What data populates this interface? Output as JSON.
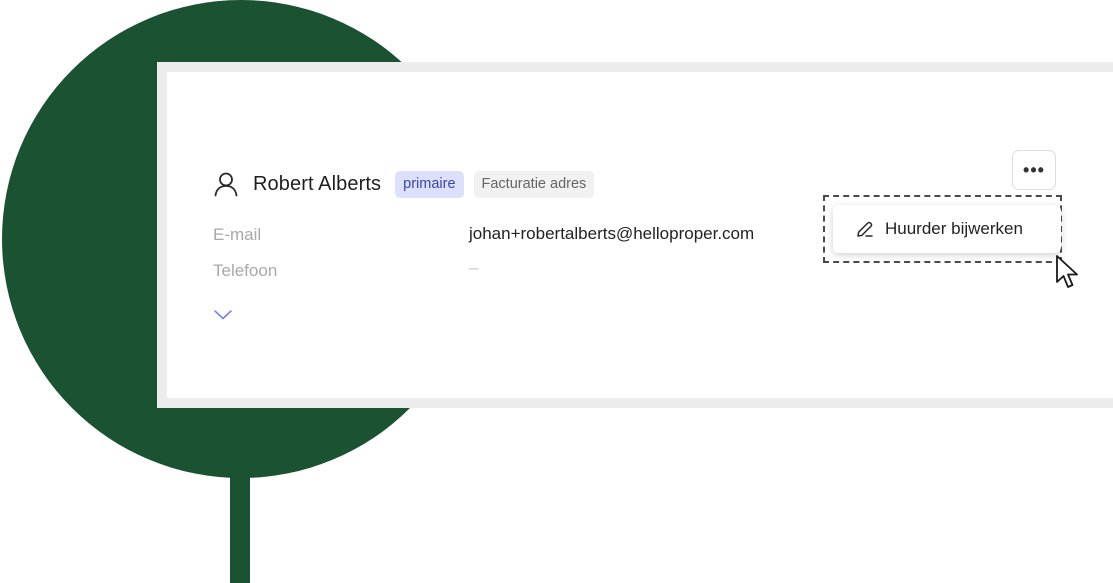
{
  "contact": {
    "name": "Robert Alberts",
    "badges": [
      "primaire",
      "Facturatie adres"
    ],
    "fields": [
      {
        "label": "E-mail",
        "value": "johan+robertalberts@helloproper.com"
      },
      {
        "label": "Telefoon",
        "value": "–"
      }
    ]
  },
  "actions": {
    "more_label": "•••",
    "menu_items": [
      {
        "label": "Huurder bijwerken",
        "icon": "pencil-icon"
      }
    ]
  },
  "colors": {
    "brand_green": "#1b5232",
    "badge_primary_bg": "#dde0fa",
    "badge_primary_text": "#3b46a8",
    "chevron": "#7b84e8"
  }
}
